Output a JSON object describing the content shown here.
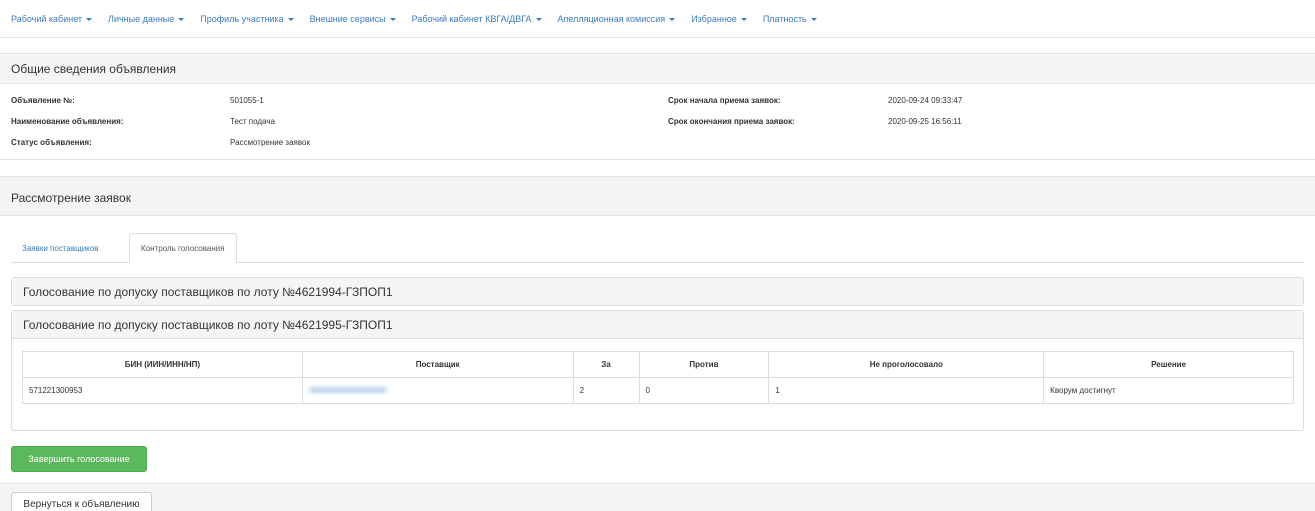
{
  "nav": {
    "items": [
      {
        "label": "Рабочий кабинет"
      },
      {
        "label": "Личные данные"
      },
      {
        "label": "Профиль участника"
      },
      {
        "label": "Внешние сервисы"
      },
      {
        "label": "Рабочий кабинет КВГА/ДВГА"
      },
      {
        "label": "Апелляционная комиссия"
      },
      {
        "label": "Избранное"
      },
      {
        "label": "Платность"
      }
    ]
  },
  "general": {
    "title": "Общие сведения объявления",
    "number_label": "Объявление №:",
    "number_value": "501055-1",
    "name_label": "Наименование объявления:",
    "name_value": "Тест подача",
    "status_label": "Статус объявления:",
    "status_value": "Рассмотрение заявок",
    "start_label": "Срок начала приема заявок:",
    "start_value": "2020-09-24 09:33:47",
    "end_label": "Срок окончания приема заявок:",
    "end_value": "2020-09-25 16:56:11"
  },
  "review": {
    "title": "Рассмотрение заявок",
    "tabs": [
      {
        "label": "Заявки поставщиков"
      },
      {
        "label": "Контроль голосования"
      }
    ],
    "lots": [
      {
        "title": "Голосование по допуску поставщиков по лоту №4621994-ГЗПОП1"
      },
      {
        "title": "Голосование по допуску поставщиков по лоту №4621995-ГЗПОП1"
      }
    ],
    "table": {
      "headers": [
        "БИН (ИИН/ИНН/НП)",
        "Поставщик",
        "За",
        "Против",
        "Не проголосовало",
        "Решение"
      ],
      "rows": [
        {
          "bin": "571221300953",
          "for": "2",
          "against": "0",
          "not_voted": "1",
          "decision": "Кворум достигнут"
        }
      ]
    },
    "finish_button": "Завершить голосование",
    "back_button": "Вернуться к объявлению"
  },
  "colors": {
    "link": "#3a7bbf",
    "success": "#5cb85c",
    "panel_bg": "#f5f5f5"
  }
}
